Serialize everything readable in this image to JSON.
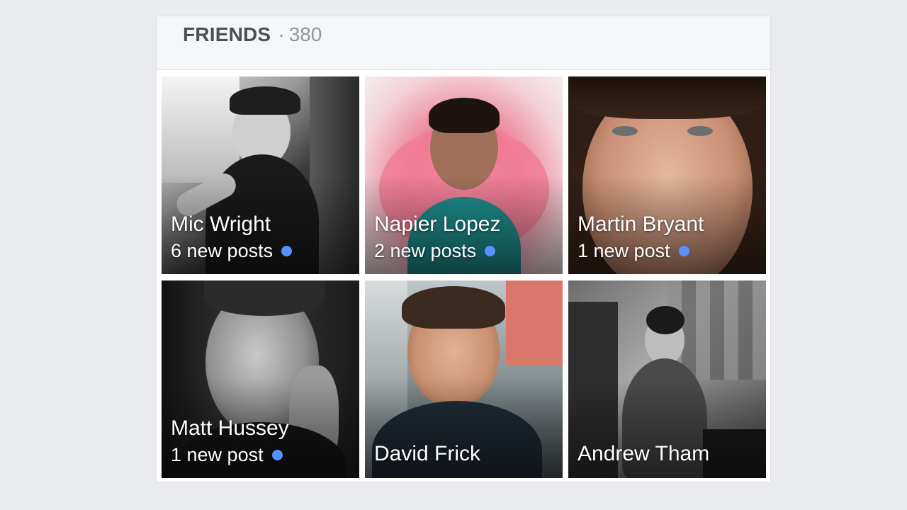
{
  "header": {
    "title": "FRIENDS",
    "separator": "·",
    "count": "380"
  },
  "colors": {
    "page_bg": "#e9ebee",
    "header_bg": "#f5f6f7",
    "header_title": "#4b4f56",
    "header_count": "#90949c",
    "new_post_dot": "#5890ff"
  },
  "friends": [
    {
      "name": "Mic Wright",
      "posts": "6 new posts",
      "has_new": true
    },
    {
      "name": "Napier Lopez",
      "posts": "2 new posts",
      "has_new": true
    },
    {
      "name": "Martin Bryant",
      "posts": "1 new post",
      "has_new": true
    },
    {
      "name": "Matt Hussey",
      "posts": "1 new post",
      "has_new": true
    },
    {
      "name": "David Frick",
      "posts": "",
      "has_new": false
    },
    {
      "name": "Andrew Tham",
      "posts": "",
      "has_new": false
    }
  ]
}
